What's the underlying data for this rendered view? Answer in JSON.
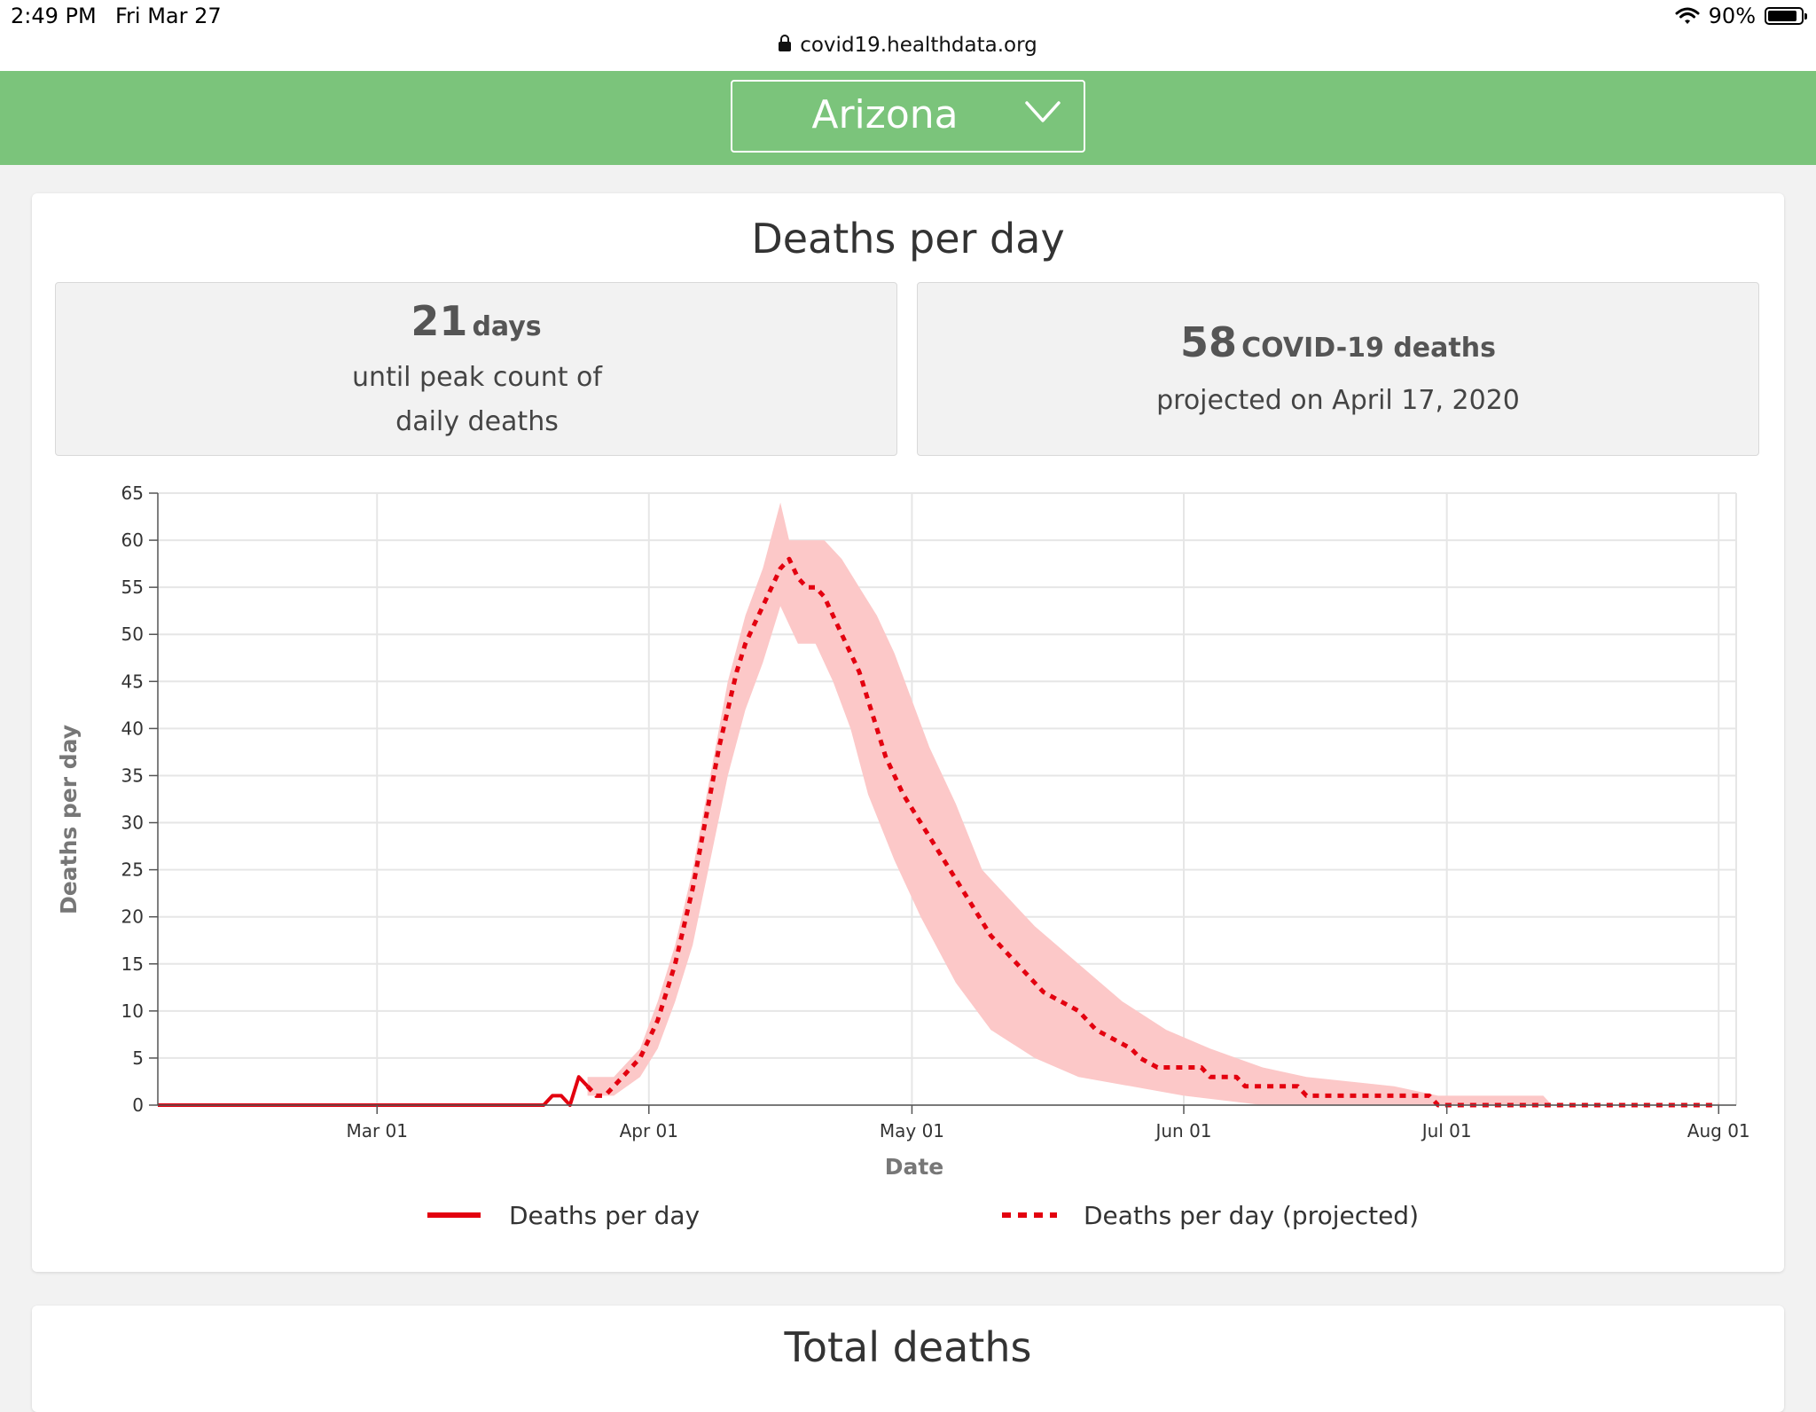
{
  "status_bar": {
    "time": "2:49 PM",
    "date": "Fri Mar 27",
    "url": "covid19.healthdata.org",
    "battery": "90%",
    "battery_level": 0.9,
    "icons": [
      "lock-icon",
      "wifi-icon",
      "battery-icon"
    ]
  },
  "header": {
    "location": "Arizona",
    "background_color": "#7bc47b"
  },
  "card": {
    "title": "Deaths per day",
    "stat_peak": {
      "value": "21",
      "unit": "days",
      "description": "until peak count of daily deaths"
    },
    "stat_projected": {
      "value": "58",
      "unit": "COVID-19 deaths",
      "description": "projected on April 17, 2020"
    }
  },
  "legend": {
    "actual": "Deaths per day",
    "projected": "Deaths per day (projected)"
  },
  "next_card": {
    "title": "Total deaths"
  },
  "chart_data": {
    "type": "line",
    "xlabel": "Date",
    "ylabel": "Deaths per day",
    "x_range": [
      "2020-02-05",
      "2020-08-03"
    ],
    "ylim": [
      0,
      65
    ],
    "y_ticks": [
      0,
      5,
      10,
      15,
      20,
      25,
      30,
      35,
      40,
      45,
      50,
      55,
      60,
      65
    ],
    "x_ticks": [
      {
        "date": "2020-03-01",
        "label": "Mar 01"
      },
      {
        "date": "2020-04-01",
        "label": "Apr 01"
      },
      {
        "date": "2020-05-01",
        "label": "May 01"
      },
      {
        "date": "2020-06-01",
        "label": "Jun 01"
      },
      {
        "date": "2020-07-01",
        "label": "Jul 01"
      },
      {
        "date": "2020-08-01",
        "label": "Aug 01"
      }
    ],
    "grid": true,
    "legend_position": "bottom",
    "colors": {
      "line": "#e3000f",
      "band": "#fcc8c8"
    },
    "series": [
      {
        "name": "Deaths per day",
        "style": "solid",
        "points": [
          [
            "2020-02-05",
            0
          ],
          [
            "2020-03-20",
            0
          ],
          [
            "2020-03-21",
            1
          ],
          [
            "2020-03-22",
            1
          ],
          [
            "2020-03-23",
            0
          ],
          [
            "2020-03-24",
            3
          ],
          [
            "2020-03-25",
            2
          ]
        ]
      },
      {
        "name": "Deaths per day (projected)",
        "style": "dotted",
        "points": [
          [
            "2020-03-25",
            2
          ],
          [
            "2020-03-26",
            1
          ],
          [
            "2020-03-27",
            1
          ],
          [
            "2020-03-28",
            2
          ],
          [
            "2020-03-29",
            3
          ],
          [
            "2020-03-30",
            4
          ],
          [
            "2020-03-31",
            5
          ],
          [
            "2020-04-01",
            7
          ],
          [
            "2020-04-02",
            9
          ],
          [
            "2020-04-03",
            12
          ],
          [
            "2020-04-04",
            15
          ],
          [
            "2020-04-05",
            19
          ],
          [
            "2020-04-06",
            23
          ],
          [
            "2020-04-07",
            28
          ],
          [
            "2020-04-08",
            33
          ],
          [
            "2020-04-09",
            38
          ],
          [
            "2020-04-10",
            42
          ],
          [
            "2020-04-11",
            46
          ],
          [
            "2020-04-12",
            49
          ],
          [
            "2020-04-13",
            51
          ],
          [
            "2020-04-14",
            53
          ],
          [
            "2020-04-15",
            55
          ],
          [
            "2020-04-16",
            57
          ],
          [
            "2020-04-17",
            58
          ],
          [
            "2020-04-18",
            56
          ],
          [
            "2020-04-19",
            55
          ],
          [
            "2020-04-20",
            55
          ],
          [
            "2020-04-21",
            54
          ],
          [
            "2020-04-22",
            52
          ],
          [
            "2020-04-23",
            50
          ],
          [
            "2020-04-24",
            48
          ],
          [
            "2020-04-25",
            46
          ],
          [
            "2020-04-26",
            43
          ],
          [
            "2020-04-27",
            40
          ],
          [
            "2020-04-28",
            37
          ],
          [
            "2020-04-29",
            35
          ],
          [
            "2020-04-30",
            33
          ],
          [
            "2020-05-02",
            30
          ],
          [
            "2020-05-04",
            27
          ],
          [
            "2020-05-06",
            24
          ],
          [
            "2020-05-08",
            21
          ],
          [
            "2020-05-10",
            18
          ],
          [
            "2020-05-12",
            16
          ],
          [
            "2020-05-14",
            14
          ],
          [
            "2020-05-16",
            12
          ],
          [
            "2020-05-18",
            11
          ],
          [
            "2020-05-20",
            10
          ],
          [
            "2020-05-21",
            9
          ],
          [
            "2020-05-22",
            8
          ],
          [
            "2020-05-24",
            7
          ],
          [
            "2020-05-26",
            6
          ],
          [
            "2020-05-27",
            5
          ],
          [
            "2020-05-29",
            4
          ],
          [
            "2020-06-03",
            4
          ],
          [
            "2020-06-04",
            3
          ],
          [
            "2020-06-07",
            3
          ],
          [
            "2020-06-08",
            2
          ],
          [
            "2020-06-14",
            2
          ],
          [
            "2020-06-15",
            1
          ],
          [
            "2020-06-29",
            1
          ],
          [
            "2020-06-30",
            0
          ],
          [
            "2020-08-01",
            0
          ]
        ]
      }
    ],
    "uncertainty_band": {
      "upper": [
        [
          "2020-03-25",
          3
        ],
        [
          "2020-03-28",
          3
        ],
        [
          "2020-03-31",
          6
        ],
        [
          "2020-04-02",
          11
        ],
        [
          "2020-04-04",
          17
        ],
        [
          "2020-04-06",
          25
        ],
        [
          "2020-04-08",
          35
        ],
        [
          "2020-04-10",
          45
        ],
        [
          "2020-04-12",
          52
        ],
        [
          "2020-04-14",
          57
        ],
        [
          "2020-04-16",
          64
        ],
        [
          "2020-04-17",
          60
        ],
        [
          "2020-04-19",
          60
        ],
        [
          "2020-04-21",
          60
        ],
        [
          "2020-04-23",
          58
        ],
        [
          "2020-04-25",
          55
        ],
        [
          "2020-04-27",
          52
        ],
        [
          "2020-04-29",
          48
        ],
        [
          "2020-05-01",
          43
        ],
        [
          "2020-05-03",
          38
        ],
        [
          "2020-05-06",
          32
        ],
        [
          "2020-05-09",
          25
        ],
        [
          "2020-05-12",
          22
        ],
        [
          "2020-05-15",
          19
        ],
        [
          "2020-05-20",
          15
        ],
        [
          "2020-05-25",
          11
        ],
        [
          "2020-05-30",
          8
        ],
        [
          "2020-06-04",
          6
        ],
        [
          "2020-06-10",
          4
        ],
        [
          "2020-06-15",
          3
        ],
        [
          "2020-06-25",
          2
        ],
        [
          "2020-06-30",
          1
        ],
        [
          "2020-07-12",
          1
        ],
        [
          "2020-07-13",
          0
        ]
      ],
      "lower": [
        [
          "2020-07-13",
          0
        ],
        [
          "2020-06-20",
          0
        ],
        [
          "2020-06-10",
          0
        ],
        [
          "2020-06-01",
          1
        ],
        [
          "2020-05-26",
          2
        ],
        [
          "2020-05-20",
          3
        ],
        [
          "2020-05-15",
          5
        ],
        [
          "2020-05-10",
          8
        ],
        [
          "2020-05-06",
          13
        ],
        [
          "2020-05-02",
          20
        ],
        [
          "2020-04-29",
          26
        ],
        [
          "2020-04-26",
          33
        ],
        [
          "2020-04-24",
          40
        ],
        [
          "2020-04-22",
          45
        ],
        [
          "2020-04-20",
          49
        ],
        [
          "2020-04-18",
          49
        ],
        [
          "2020-04-16",
          53
        ],
        [
          "2020-04-14",
          47
        ],
        [
          "2020-04-12",
          42
        ],
        [
          "2020-04-10",
          35
        ],
        [
          "2020-04-08",
          26
        ],
        [
          "2020-04-06",
          17
        ],
        [
          "2020-04-04",
          11
        ],
        [
          "2020-04-02",
          6
        ],
        [
          "2020-03-31",
          3
        ],
        [
          "2020-03-28",
          1
        ],
        [
          "2020-03-25",
          1
        ]
      ]
    }
  }
}
